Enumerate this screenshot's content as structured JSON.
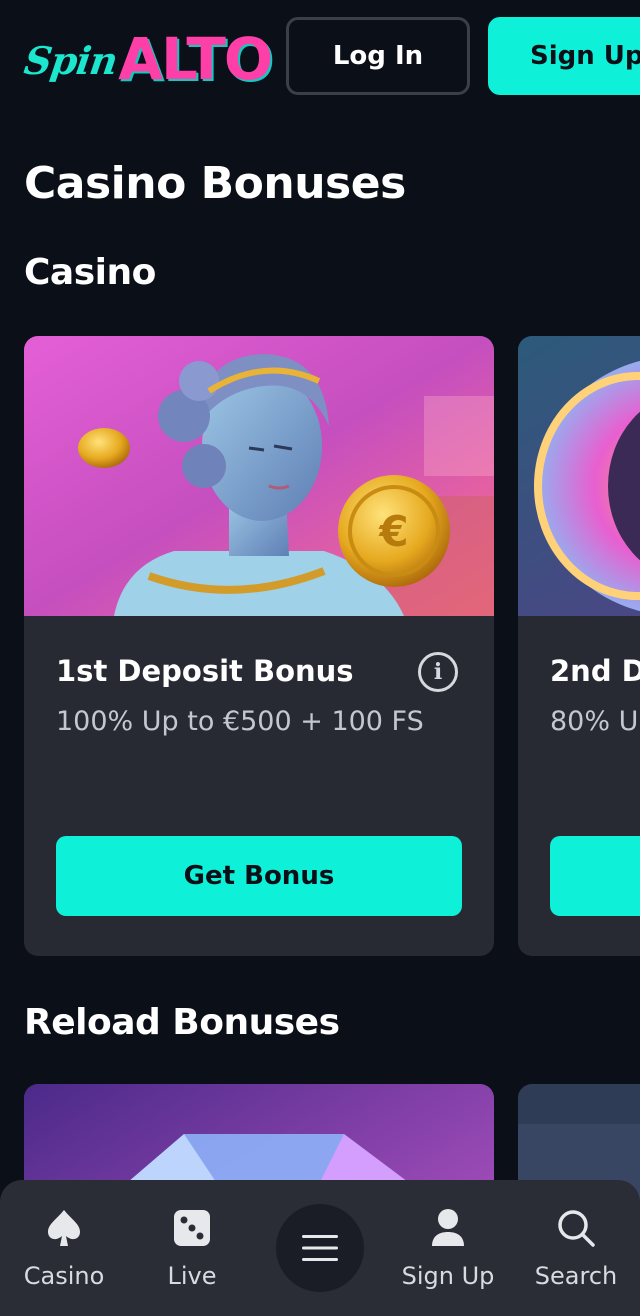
{
  "header": {
    "logo_spin": "Spin",
    "logo_alto": "ALTO",
    "login_label": "Log In",
    "signup_label": "Sign Up"
  },
  "page_title": "Casino Bonuses",
  "sections": [
    {
      "title": "Casino",
      "cards": [
        {
          "title": "1st Deposit Bonus",
          "subtitle": "100% Up to €500 + 100 FS",
          "button": "Get Bonus"
        },
        {
          "title": "2nd D",
          "subtitle": "80% U",
          "button": ""
        }
      ]
    },
    {
      "title": "Reload Bonuses",
      "cards": []
    }
  ],
  "bottom_nav": {
    "items": [
      {
        "label": "Casino",
        "icon": "spade-icon"
      },
      {
        "label": "Live",
        "icon": "dice-icon"
      },
      {
        "label": "",
        "icon": "menu-icon"
      },
      {
        "label": "Sign Up",
        "icon": "user-icon"
      },
      {
        "label": "Search",
        "icon": "search-icon"
      }
    ]
  },
  "colors": {
    "background": "#0b0f17",
    "accent": "#0ff0d8",
    "logo_pink": "#ff3fa8",
    "card": "#272a33",
    "nav": "#2a2d36"
  }
}
